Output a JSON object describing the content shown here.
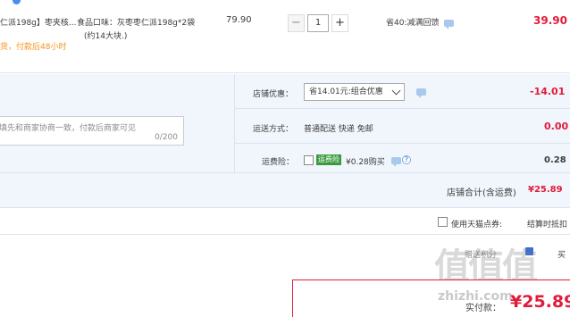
{
  "product": {
    "title": "仁派198g】枣夹核...",
    "sku_line1": "食品口味：灰枣枣仁派198g*2袋",
    "sku_line2": "(约14大块.)",
    "delivery_note": "货，付款后48小时",
    "unit_price": "79.90",
    "quantity": "1",
    "minus_label": "−",
    "plus_label": "+",
    "discount_note": "省40:减满回馈",
    "subtotal": "39.90"
  },
  "shop": {
    "message_placeholder": "填先和商家协商一致，付款后商家可见",
    "message_count": "0/200",
    "coupon_label": "店铺优惠：",
    "coupon_select": "省14.01元:组合优惠",
    "coupon_value": "-14.01",
    "shipping_label": "运送方式：",
    "shipping_method": "普通配送 快递 免邮",
    "shipping_value": "0.00",
    "insurance_label": "运费险：",
    "insurance_badge": "运费险",
    "insurance_text": "¥0.28购买",
    "insurance_value": "0.28",
    "total_label": "店铺合计(含运费)",
    "total_value": "¥25.89"
  },
  "footer": {
    "tmall_points": "使用天猫点券:",
    "settle_label": "结算时抵扣",
    "peek_text": "赠送积分",
    "peek_text2": "买",
    "final_label": "实付款：",
    "final_price": "¥25.89",
    "watermark": "值值值",
    "watermark_url": "zhizhi.com"
  },
  "colors": {
    "accent_red": "#e01c3b",
    "orange": "#f7941d",
    "panel_blue": "#f1f6fd",
    "badge_green": "#3a9b3d"
  },
  "icons": [
    "chat-icon",
    "help-icon",
    "chevron-down-icon",
    "checkbox-icon"
  ]
}
